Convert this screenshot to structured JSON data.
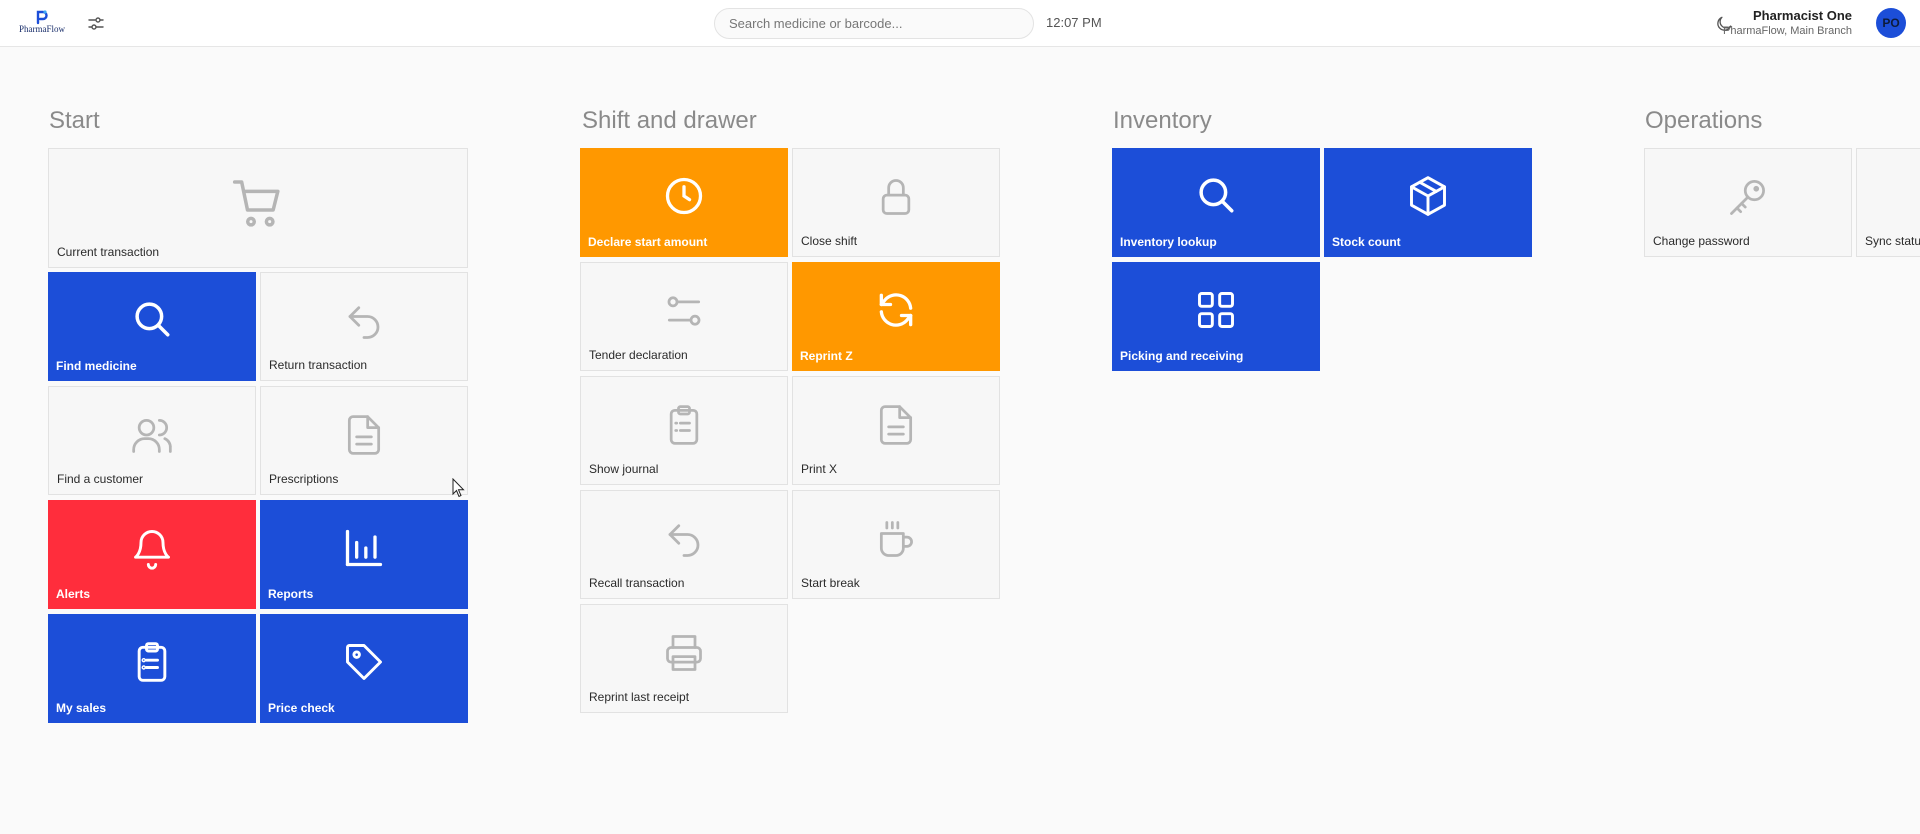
{
  "header": {
    "logo_text": "PharmaFlow",
    "search_placeholder": "Search medicine or barcode...",
    "time": "12:07 PM",
    "user_name": "Pharmacist One",
    "user_branch": "PharmaFlow, Main Branch",
    "avatar_initials": "PO"
  },
  "sections": {
    "start": {
      "title": "Start",
      "tiles": {
        "current_transaction": "Current transaction",
        "find_medicine": "Find medicine",
        "return_transaction": "Return transaction",
        "find_customer": "Find a customer",
        "prescriptions": "Prescriptions",
        "alerts": "Alerts",
        "reports": "Reports",
        "my_sales": "My sales",
        "price_check": "Price check"
      }
    },
    "shift": {
      "title": "Shift and drawer",
      "tiles": {
        "declare_start_amount": "Declare start amount",
        "close_shift": "Close shift",
        "tender_declaration": "Tender declaration",
        "reprint_z": "Reprint Z",
        "show_journal": "Show journal",
        "print_x": "Print X",
        "recall_transaction": "Recall transaction",
        "start_break": "Start break",
        "reprint_last_receipt": "Reprint last receipt"
      }
    },
    "inventory": {
      "title": "Inventory",
      "tiles": {
        "inventory_lookup": "Inventory lookup",
        "stock_count": "Stock count",
        "picking_receiving": "Picking and receiving"
      }
    },
    "operations": {
      "title": "Operations",
      "tiles": {
        "change_password": "Change password",
        "sync_status": "Sync status"
      }
    }
  },
  "colors": {
    "blue": "#1c4ed8",
    "orange": "#ff9800",
    "red": "#ff2d3c",
    "icon_gray": "#b5b5b5"
  }
}
